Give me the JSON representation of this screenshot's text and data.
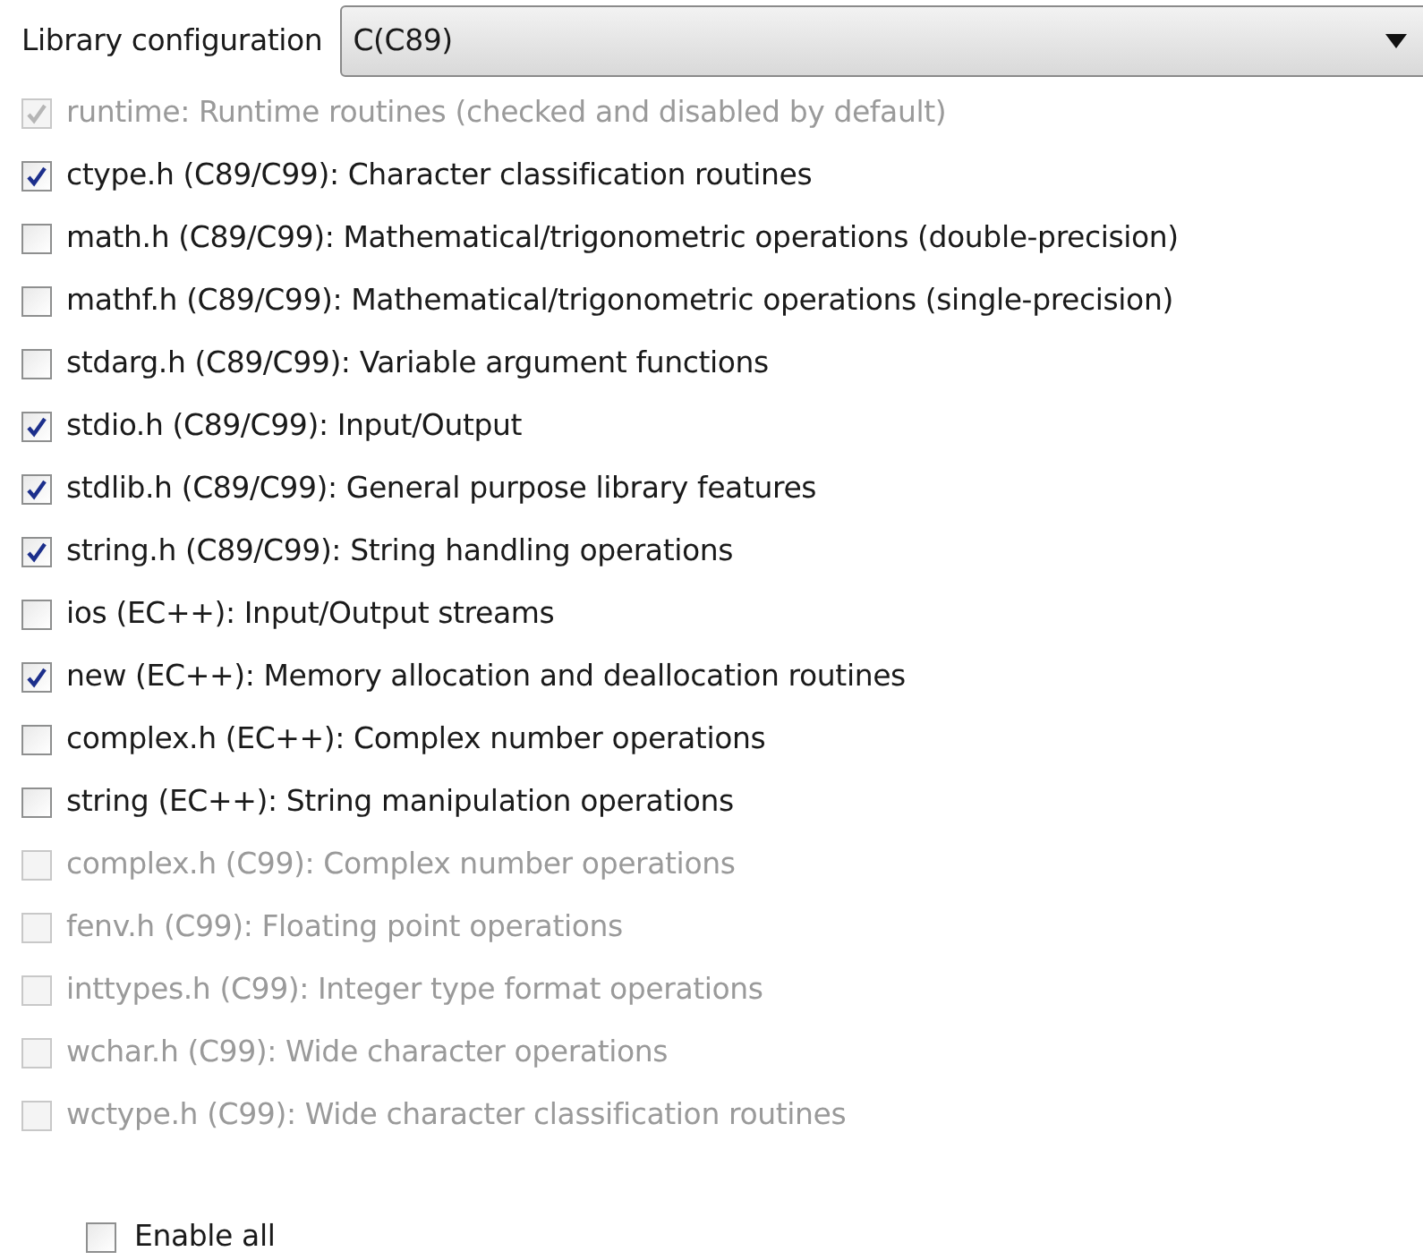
{
  "library_configuration": {
    "label": "Library configuration",
    "value": "C(C89)"
  },
  "options": [
    {
      "label": "runtime: Runtime routines (checked and disabled by default)",
      "checked": true,
      "disabled": true
    },
    {
      "label": "ctype.h (C89/C99): Character classification routines",
      "checked": true,
      "disabled": false
    },
    {
      "label": "math.h (C89/C99): Mathematical/trigonometric operations (double-precision)",
      "checked": false,
      "disabled": false
    },
    {
      "label": "mathf.h (C89/C99): Mathematical/trigonometric operations (single-precision)",
      "checked": false,
      "disabled": false
    },
    {
      "label": "stdarg.h (C89/C99): Variable argument functions",
      "checked": false,
      "disabled": false
    },
    {
      "label": "stdio.h (C89/C99): Input/Output",
      "checked": true,
      "disabled": false
    },
    {
      "label": "stdlib.h (C89/C99): General purpose library features",
      "checked": true,
      "disabled": false
    },
    {
      "label": "string.h (C89/C99): String handling operations",
      "checked": true,
      "disabled": false
    },
    {
      "label": "ios (EC++): Input/Output streams",
      "checked": false,
      "disabled": false
    },
    {
      "label": "new (EC++): Memory allocation and deallocation routines",
      "checked": true,
      "disabled": false
    },
    {
      "label": "complex.h (EC++): Complex number operations",
      "checked": false,
      "disabled": false
    },
    {
      "label": "string (EC++): String manipulation operations",
      "checked": false,
      "disabled": false
    },
    {
      "label": "complex.h (C99): Complex number operations",
      "checked": false,
      "disabled": true
    },
    {
      "label": "fenv.h (C99): Floating point operations",
      "checked": false,
      "disabled": true
    },
    {
      "label": "inttypes.h (C99): Integer type format operations",
      "checked": false,
      "disabled": true
    },
    {
      "label": "wchar.h (C99): Wide character operations",
      "checked": false,
      "disabled": true
    },
    {
      "label": "wctype.h (C99): Wide character classification routines",
      "checked": false,
      "disabled": true
    }
  ],
  "enable_all": {
    "label": "Enable all",
    "checked": false
  }
}
